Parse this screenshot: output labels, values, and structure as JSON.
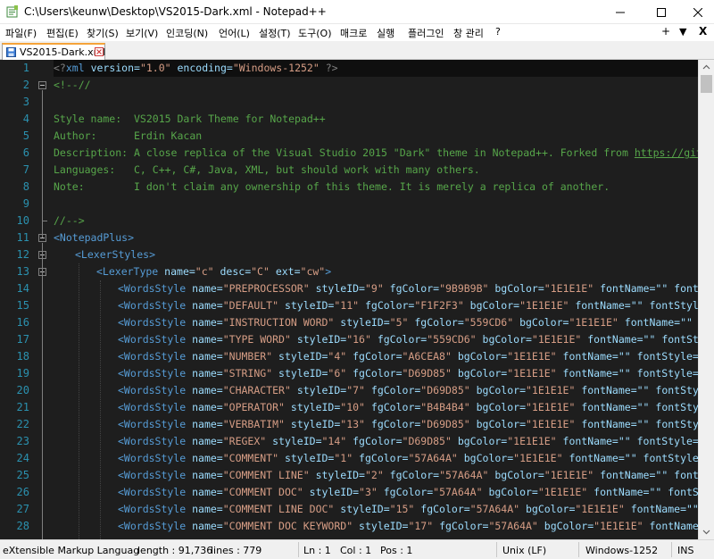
{
  "window": {
    "title": "C:\\Users\\keunw\\Desktop\\VS2015-Dark.xml - Notepad++"
  },
  "menu": {
    "items": [
      "파일(F)",
      "편집(E)",
      "찾기(S)",
      "보기(V)",
      "인코딩(N)",
      "언어(L)",
      "설정(T)",
      "도구(O)",
      "매크로",
      "실행",
      "플러그인",
      "창 관리",
      "?"
    ],
    "right_plus": "+",
    "right_down": "▼",
    "right_close": "X"
  },
  "tab": {
    "label": "VS2015-Dark.xml"
  },
  "editor": {
    "line_numbers": [
      "1",
      "2",
      "3",
      "4",
      "5",
      "6",
      "7",
      "8",
      "9",
      "10",
      "11",
      "12",
      "13",
      "14",
      "15",
      "16",
      "17",
      "18",
      "19",
      "20",
      "21",
      "22",
      "23",
      "24",
      "25",
      "26",
      "27",
      "28"
    ],
    "lines": {
      "l1": [
        "<?",
        "xml",
        " version=",
        "\"1.0\"",
        " encoding=",
        "\"Windows-1252\"",
        " ?>"
      ],
      "l2": "<!--//",
      "l4": "Style name:  VS2015 Dark Theme for Notepad++",
      "l5": "Author:      Erdin Kacan",
      "l6_text": "Description: A close replica of the Visual Studio 2015 \"Dark\" theme in Notepad++. Forked from ",
      "l6_url": "https://github.com/SeanClin",
      "l7": "Languages:   C, C++, C#, Java, XML, but should work with many others.",
      "l8": "Note:        I don't claim any ownership of this theme. It is merely a replica of another.",
      "l10": "//-->",
      "l11": "<NotepadPlus>",
      "l12": "<LexerStyles>",
      "l13": [
        "<LexerType",
        " name=",
        "\"c\"",
        " desc=",
        "\"C\"",
        " ext=",
        "\"cw\"",
        ">"
      ],
      "words": [
        {
          "name": "\"PREPROCESSOR\"",
          "styleID": "\"9\"",
          "fg": "\"9B9B9B\"",
          "bg": "\"1E1E1E\"",
          "rest": " fontName=\"\" fontStyle=\"0\" fontS"
        },
        {
          "name": "\"DEFAULT\"",
          "styleID": "\"11\"",
          "fg": "\"F1F2F3\"",
          "bg": "\"1E1E1E\"",
          "rest": " fontName=\"\" fontStyle=\"0\" fontSize="
        },
        {
          "name": "\"INSTRUCTION WORD\"",
          "styleID": "\"5\"",
          "fg": "\"559CD6\"",
          "bg": "\"1E1E1E\"",
          "rest": " fontName=\"\" fontStyle=\"0\" fo"
        },
        {
          "name": "\"TYPE WORD\"",
          "styleID": "\"16\"",
          "fg": "\"559CD6\"",
          "bg": "\"1E1E1E\"",
          "rest": " fontName=\"\" fontStyle=\"0\" fontSiz"
        },
        {
          "name": "\"NUMBER\"",
          "styleID": "\"4\"",
          "fg": "\"A6CEA8\"",
          "bg": "\"1E1E1E\"",
          "rest": " fontName=\"\" fontStyle=\"0\" fontSize=\""
        },
        {
          "name": "\"STRING\"",
          "styleID": "\"6\"",
          "fg": "\"D69D85\"",
          "bg": "\"1E1E1E\"",
          "rest": " fontName=\"\" fontStyle=\"0\" fontSize=\""
        },
        {
          "name": "\"CHARACTER\"",
          "styleID": "\"7\"",
          "fg": "\"D69D85\"",
          "bg": "\"1E1E1E\"",
          "rest": " fontName=\"\" fontStyle=\"0\" fontSize"
        },
        {
          "name": "\"OPERATOR\"",
          "styleID": "\"10\"",
          "fg": "\"B4B4B4\"",
          "bg": "\"1E1E1E\"",
          "rest": " fontName=\"\" fontStyle=\"0\" fontSiz"
        },
        {
          "name": "\"VERBATIM\"",
          "styleID": "\"13\"",
          "fg": "\"D69D85\"",
          "bg": "\"1E1E1E\"",
          "rest": " fontName=\"\" fontStyle=\"0\" fontSiz"
        },
        {
          "name": "\"REGEX\"",
          "styleID": "\"14\"",
          "fg": "\"D69D85\"",
          "bg": "\"1E1E1E\"",
          "rest": " fontName=\"\" fontStyle=\"0\" fontSize=\""
        },
        {
          "name": "\"COMMENT\"",
          "styleID": "\"1\"",
          "fg": "\"57A64A\"",
          "bg": "\"1E1E1E\"",
          "rest": " fontName=\"\" fontStyle=\"0\" fontSize="
        },
        {
          "name": "\"COMMENT LINE\"",
          "styleID": "\"2\"",
          "fg": "\"57A64A\"",
          "bg": "\"1E1E1E\"",
          "rest": " fontName=\"\" fontStyle=\"0\" fontS"
        },
        {
          "name": "\"COMMENT DOC\"",
          "styleID": "\"3\"",
          "fg": "\"57A64A\"",
          "bg": "\"1E1E1E\"",
          "rest": " fontName=\"\" fontStyle=\"0\" fontSi"
        },
        {
          "name": "\"COMMENT LINE DOC\"",
          "styleID": "\"15\"",
          "fg": "\"57A64A\"",
          "bg": "\"1E1E1E\"",
          "rest": " fontName=\"\" fontStyle=\"0\""
        },
        {
          "name": "\"COMMENT DOC KEYWORD\"",
          "styleID": "\"17\"",
          "fg": "\"57A64A\"",
          "bg": "\"1E1E1E\"",
          "rest": " fontName=\"\" fontStyle=\""
        }
      ]
    }
  },
  "statusbar": {
    "filetype": "eXtensible Markup Language file",
    "length": "length : 91,736",
    "lines": "lines : 779",
    "ln": "Ln : 1",
    "col": "Col : 1",
    "pos": "Pos : 1",
    "eol": "Unix (LF)",
    "encoding": "Windows-1252",
    "mode": "INS"
  },
  "colors": {
    "editor_bg": "#1E1E1E",
    "line_number": "#2B91AF",
    "tag": "#569CD6",
    "attribute": "#9CDCFE",
    "string": "#D69D85",
    "comment": "#57A64A",
    "tab_accent": "#F5A33A"
  }
}
